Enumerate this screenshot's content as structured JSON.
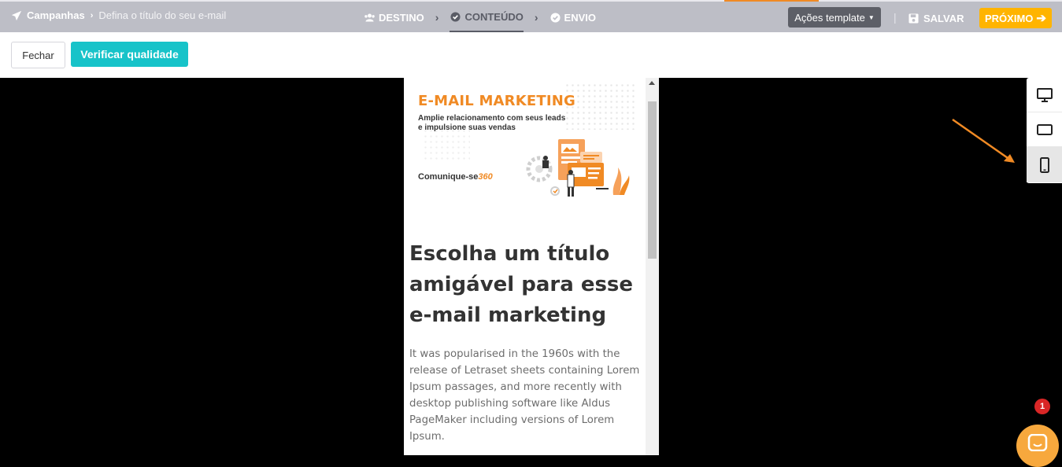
{
  "header": {
    "breadcrumb_root": "Campanhas",
    "breadcrumb_current": "Defina o título do seu e-mail",
    "steps": [
      {
        "label": "DESTINO",
        "icon": "users-icon"
      },
      {
        "label": "CONTEÚDO",
        "icon": "check-circle-icon",
        "active": true
      },
      {
        "label": "ENVIO",
        "icon": "check-circle-icon"
      }
    ],
    "template_actions": "Ações template",
    "save_label": "SALVAR",
    "next_label": "PRÓXIMO"
  },
  "toolbar": {
    "close_label": "Fechar",
    "quality_label": "Verificar qualidade"
  },
  "preview": {
    "banner_title": "E-MAIL MARKETING",
    "banner_subtitle": "Amplie relacionamento com seus leads e impulsione suas vendas",
    "banner_logo_text": "Comunique-se",
    "banner_logo_number": "360",
    "headline": "Escolha um título amigável para esse e-mail marketing",
    "body": "It was popularised in the 1960s with the release of Letraset sheets containing Lorem Ipsum passages, and more recently with desktop publishing software like Aldus PageMaker including versions of Lorem Ipsum."
  },
  "devices": [
    {
      "icon": "desktop-icon"
    },
    {
      "icon": "tablet-icon"
    },
    {
      "icon": "mobile-icon",
      "selected": true
    }
  ],
  "notification_count": "1",
  "colors": {
    "header_bg": "#bdbec6",
    "accent_orange": "#f08a24",
    "quality_teal": "#17c3c9",
    "next_yellow": "#ffb400"
  }
}
